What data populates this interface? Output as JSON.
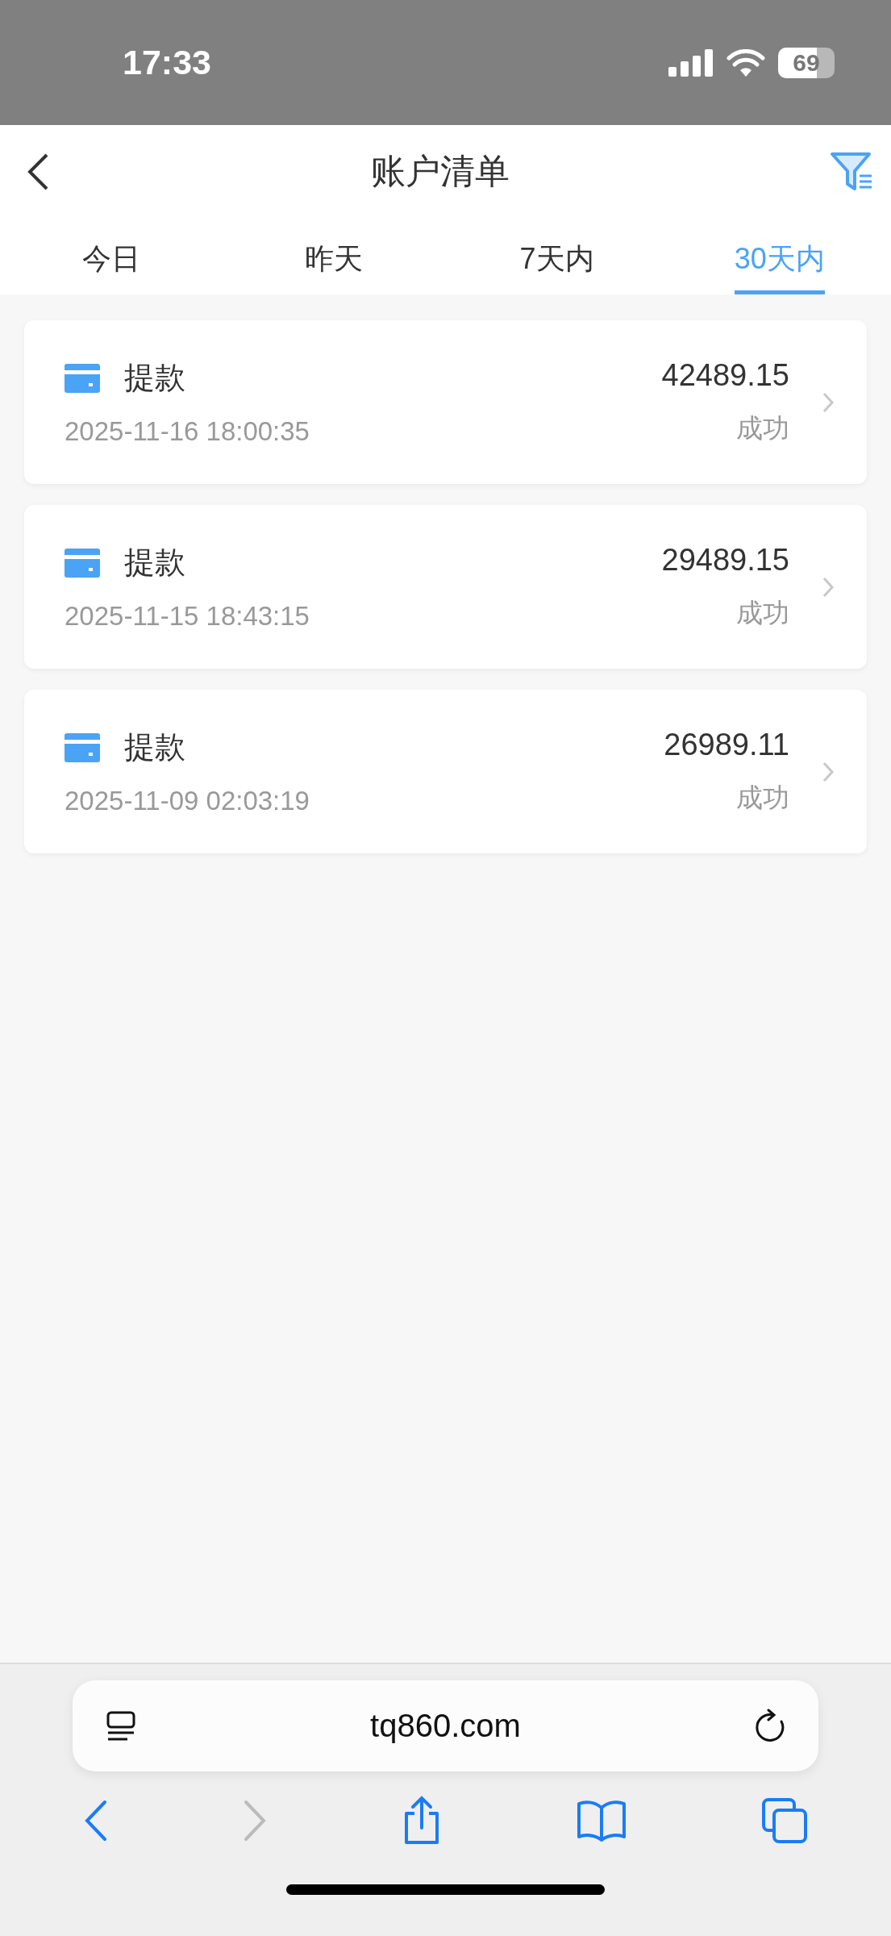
{
  "status_bar": {
    "time": "17:33",
    "battery": "69"
  },
  "header": {
    "title": "账户清单"
  },
  "tabs": [
    {
      "label": "今日",
      "selected": false
    },
    {
      "label": "昨天",
      "selected": false
    },
    {
      "label": "7天内",
      "selected": false
    },
    {
      "label": "30天内",
      "selected": true
    }
  ],
  "records": [
    {
      "type": "提款",
      "amount": "42489.15",
      "time": "2025-11-16 18:00:35",
      "status": "成功"
    },
    {
      "type": "提款",
      "amount": "29489.15",
      "time": "2025-11-15 18:43:15",
      "status": "成功"
    },
    {
      "type": "提款",
      "amount": "26989.11",
      "time": "2025-11-09 02:03:19",
      "status": "成功"
    }
  ],
  "browser": {
    "url": "tq860.com",
    "back_disabled": false,
    "forward_disabled": true
  }
}
